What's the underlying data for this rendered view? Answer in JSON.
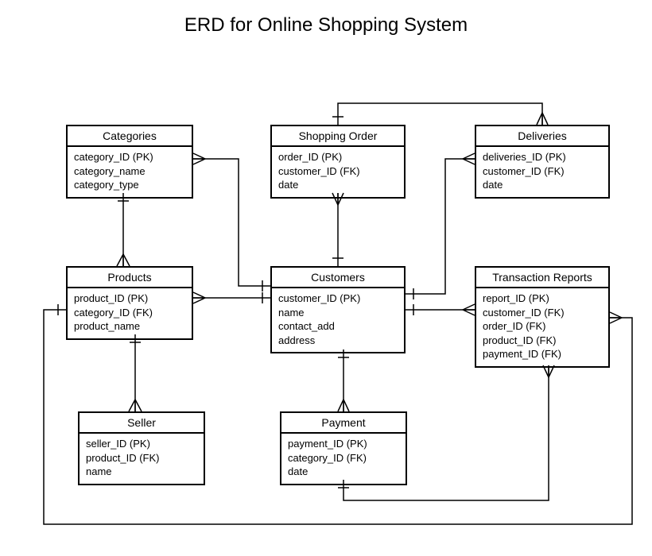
{
  "title": "ERD for Online Shopping System",
  "entities": {
    "categories": {
      "name": "Categories",
      "attrs": [
        "category_ID (PK)",
        "category_name",
        "category_type"
      ]
    },
    "shopping_order": {
      "name": "Shopping Order",
      "attrs": [
        "order_ID (PK)",
        "customer_ID (FK)",
        "date"
      ]
    },
    "deliveries": {
      "name": "Deliveries",
      "attrs": [
        "deliveries_ID (PK)",
        "customer_ID (FK)",
        "date"
      ]
    },
    "products": {
      "name": "Products",
      "attrs": [
        "product_ID (PK)",
        "category_ID (FK)",
        "product_name"
      ]
    },
    "customers": {
      "name": "Customers",
      "attrs": [
        "customer_ID (PK)",
        "name",
        "contact_add",
        "address"
      ]
    },
    "transaction_reports": {
      "name": "Transaction Reports",
      "attrs": [
        "report_ID (PK)",
        "customer_ID (FK)",
        "order_ID (FK)",
        "product_ID (FK)",
        "payment_ID (FK)"
      ]
    },
    "seller": {
      "name": "Seller",
      "attrs": [
        "seller_ID (PK)",
        "product_ID (FK)",
        "name"
      ]
    },
    "payment": {
      "name": "Payment",
      "attrs": [
        "payment_ID (PK)",
        "category_ID (FK)",
        "date"
      ]
    }
  },
  "relationships": [
    {
      "from": "categories",
      "to": "products",
      "type": "one-to-many"
    },
    {
      "from": "customers",
      "to": "shopping_order",
      "type": "one-to-many"
    },
    {
      "from": "customers",
      "to": "categories",
      "type": "one-to-many"
    },
    {
      "from": "customers",
      "to": "products",
      "type": "one-to-many"
    },
    {
      "from": "customers",
      "to": "deliveries",
      "type": "one-to-many"
    },
    {
      "from": "customers",
      "to": "transaction_reports",
      "type": "one-to-many"
    },
    {
      "from": "customers",
      "to": "payment",
      "type": "one-to-many"
    },
    {
      "from": "products",
      "to": "seller",
      "type": "one-to-many"
    },
    {
      "from": "shopping_order",
      "to": "deliveries",
      "type": "one-to-many"
    },
    {
      "from": "products",
      "to": "transaction_reports",
      "type": "one-to-many"
    },
    {
      "from": "payment",
      "to": "transaction_reports",
      "type": "one-to-many"
    }
  ]
}
